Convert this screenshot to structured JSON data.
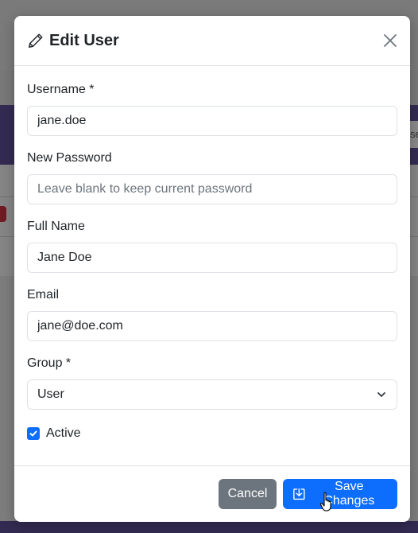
{
  "modal": {
    "title": "Edit User",
    "title_icon": "pencil-icon",
    "close_icon": "close-icon"
  },
  "form": {
    "username": {
      "label": "Username *",
      "value": "jane.doe"
    },
    "password": {
      "label": "New Password",
      "value": "",
      "placeholder": "Leave blank to keep current password"
    },
    "full_name": {
      "label": "Full Name",
      "value": "Jane Doe"
    },
    "email": {
      "label": "Email",
      "value": "jane@doe.com"
    },
    "group": {
      "label": "Group *",
      "selected": "User"
    },
    "active": {
      "label": "Active",
      "checked": true
    }
  },
  "footer": {
    "cancel_label": "Cancel",
    "save_label": "Save Changes",
    "save_icon": "save-download-icon"
  },
  "colors": {
    "primary": "#0d6efd",
    "secondary": "#6c757d",
    "backdrop_purple": "#342b52"
  }
}
